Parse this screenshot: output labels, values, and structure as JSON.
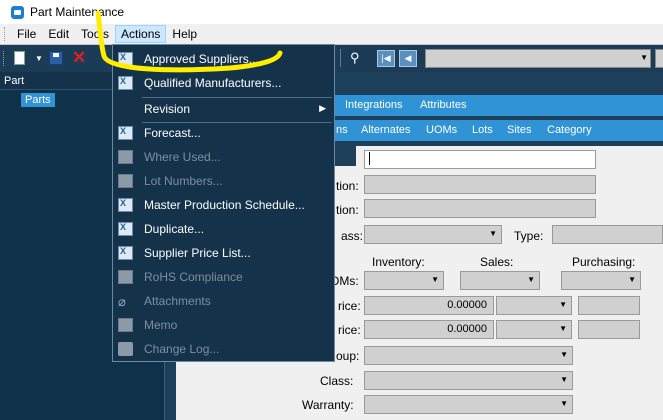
{
  "window": {
    "title": "Part Maintenance"
  },
  "menubar": {
    "items": [
      "File",
      "Edit",
      "Tools",
      "Actions",
      "Help"
    ],
    "active": "Actions"
  },
  "toolbar": {
    "icons": [
      "new-icon",
      "save-icon",
      "delete-icon",
      "find-icon",
      "first-record-icon",
      "previous-record-icon"
    ]
  },
  "tree": {
    "header": "Part",
    "node": "Parts"
  },
  "tabs_row1": [
    "Integrations",
    "Attributes"
  ],
  "tabs_row2": [
    "ns",
    "Alternates",
    "UOMs",
    "Lots",
    "Sites",
    "Category"
  ],
  "form": {
    "labels": {
      "tion1": "tion:",
      "tion2": "tion:",
      "class_cut": "ass:",
      "type": "Type:",
      "inventory": "Inventory:",
      "sales": "Sales:",
      "purchasing": "Purchasing:",
      "uoms": "OMs:",
      "rice1": "rice:",
      "rice2": "rice:",
      "oup": "oup:",
      "class": "Class:",
      "warranty": "Warranty:"
    },
    "values": {
      "price1": "0.00000",
      "price2": "0.00000"
    }
  },
  "actions_menu": {
    "items": [
      {
        "label": "Approved Suppliers...",
        "enabled": true,
        "icon": "excel-icon"
      },
      {
        "label": "Qualified Manufacturers...",
        "enabled": true,
        "icon": "excel-icon"
      },
      {
        "label": "Revision",
        "enabled": true,
        "icon": "",
        "submenu": true
      },
      {
        "label": "Forecast...",
        "enabled": true,
        "icon": "excel-icon"
      },
      {
        "label": "Where Used...",
        "enabled": false,
        "icon": "window-icon"
      },
      {
        "label": "Lot Numbers...",
        "enabled": false,
        "icon": "excel-icon"
      },
      {
        "label": "Master Production Schedule...",
        "enabled": true,
        "icon": "excel-icon"
      },
      {
        "label": "Duplicate...",
        "enabled": true,
        "icon": "window-icon"
      },
      {
        "label": "Supplier Price List...",
        "enabled": true,
        "icon": "excel-icon"
      },
      {
        "label": "RoHS Compliance",
        "enabled": false,
        "icon": "excel-icon"
      },
      {
        "label": "Attachments",
        "enabled": false,
        "icon": "paperclip-icon"
      },
      {
        "label": "Memo",
        "enabled": false,
        "icon": "memo-icon"
      },
      {
        "label": "Change Log...",
        "enabled": false,
        "icon": "book-icon"
      }
    ]
  },
  "colors": {
    "panel_bg": "#1e3f5a",
    "tab_bar": "#2f93d5",
    "menu_bg": "#14324a",
    "annotation": "#ffee00"
  }
}
